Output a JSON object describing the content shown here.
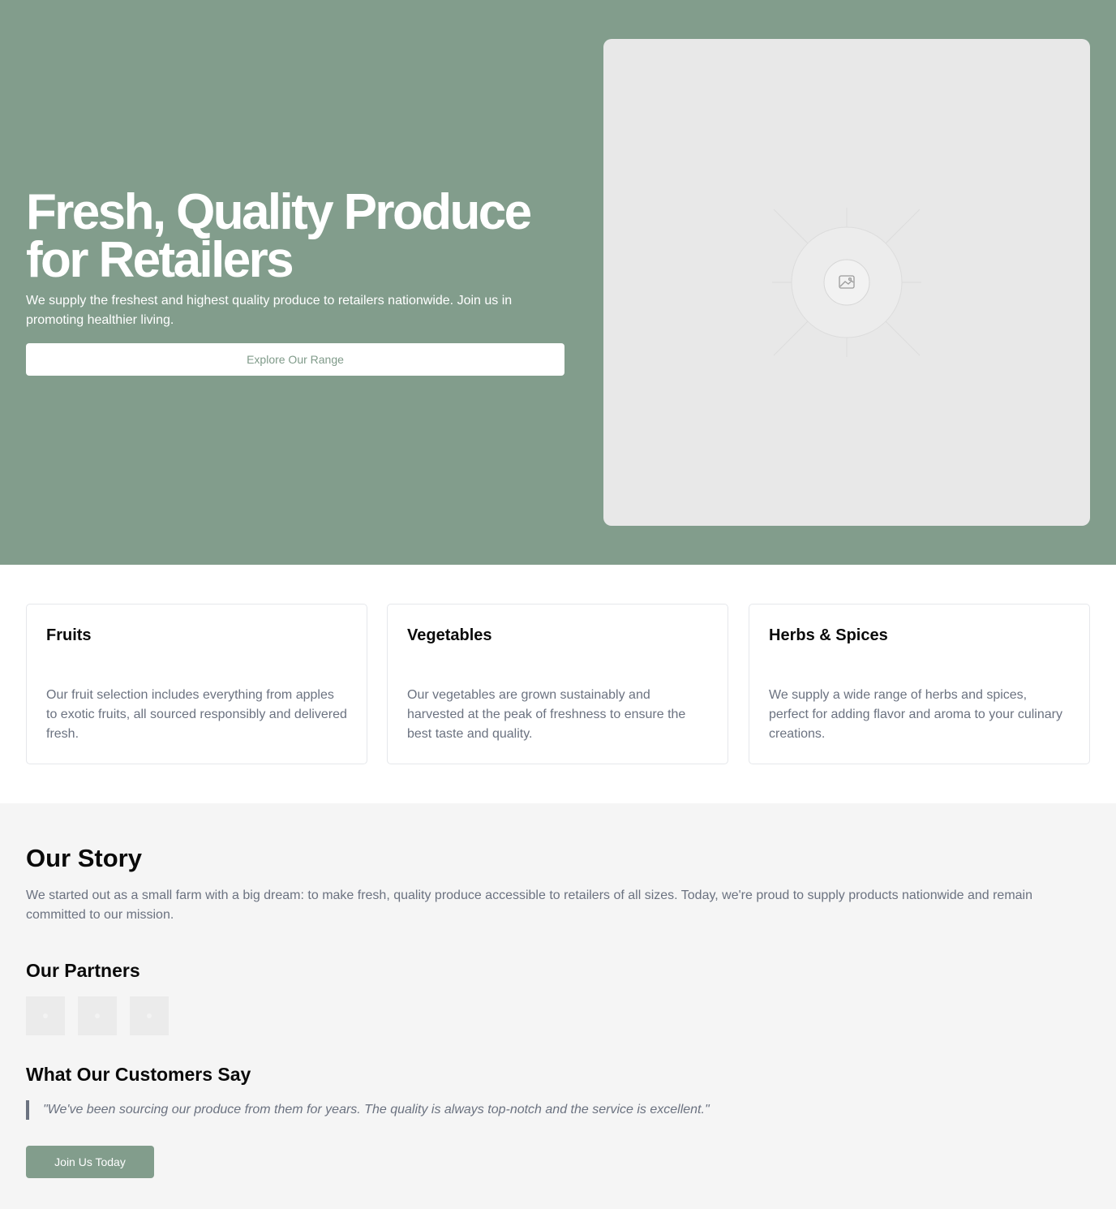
{
  "hero": {
    "title": "Fresh, Quality Produce for Retailers",
    "subtitle": "We supply the freshest and highest quality produce to retailers nationwide. Join us in promoting healthier living.",
    "cta_label": "Explore Our Range",
    "image_icon": "image-placeholder-icon"
  },
  "categories": [
    {
      "title": "Fruits",
      "description": "Our fruit selection includes everything from apples to exotic fruits, all sourced responsibly and delivered fresh."
    },
    {
      "title": "Vegetables",
      "description": "Our vegetables are grown sustainably and harvested at the peak of freshness to ensure the best taste and quality."
    },
    {
      "title": "Herbs & Spices",
      "description": "We supply a wide range of herbs and spices, perfect for adding flavor and aroma to your culinary creations."
    }
  ],
  "story": {
    "title": "Our Story",
    "text": "We started out as a small farm with a big dream: to make fresh, quality produce accessible to retailers of all sizes. Today, we're proud to supply products nationwide and remain committed to our mission."
  },
  "partners": {
    "title": "Our Partners",
    "logo_count": 3
  },
  "testimonials": {
    "title": "What Our Customers Say",
    "quote": "\"We've been sourcing our produce from them for years. The quality is always top-notch and the service is excellent.\""
  },
  "join_label": "Join Us Today",
  "colors": {
    "brand_green": "#829d8c",
    "muted_text": "#6b7280",
    "section_bg": "#f5f5f5"
  }
}
